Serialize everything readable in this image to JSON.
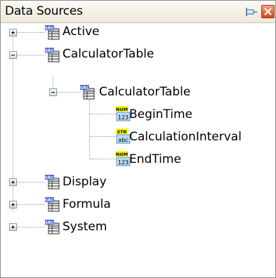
{
  "panel": {
    "title": "Data Sources",
    "pin_icon": "pin-icon",
    "close_icon": "close-icon"
  },
  "tree": {
    "nodes": [
      {
        "label": "Active",
        "level": 0,
        "state": "collapsed",
        "icon": "src-table-icon"
      },
      {
        "label": "CalculatorTable",
        "level": 0,
        "state": "expanded",
        "icon": "src-table-icon"
      },
      {
        "label": "CalculatorTable",
        "level": 1,
        "state": "expanded",
        "icon": "src-table-icon"
      },
      {
        "label": "BeginTime",
        "level": 2,
        "state": "leaf",
        "icon": "num-field-icon",
        "icon_top": "NUM",
        "icon_bottom": "123"
      },
      {
        "label": "CalculationInterval",
        "level": 2,
        "state": "leaf",
        "icon": "str-field-icon",
        "icon_top": "STR",
        "icon_bottom": "abc"
      },
      {
        "label": "EndTime",
        "level": 2,
        "state": "leaf",
        "icon": "num-field-icon",
        "icon_top": "NUM",
        "icon_bottom": "123"
      },
      {
        "label": "Display",
        "level": 0,
        "state": "collapsed",
        "icon": "src-table-icon"
      },
      {
        "label": "Formula",
        "level": 0,
        "state": "collapsed",
        "icon": "src-table-icon"
      },
      {
        "label": "System",
        "level": 0,
        "state": "collapsed",
        "icon": "src-table-icon"
      }
    ]
  },
  "colors": {
    "titlebar": "#ece9d8",
    "close_button": "#d8471a",
    "tree_lines": "#9a9a9a",
    "expander_border": "#7f9db9",
    "src_icon_blue": "#3a58c8",
    "num_icon_yellow": "#ffff00",
    "str_icon_yellow": "#ffff00"
  }
}
